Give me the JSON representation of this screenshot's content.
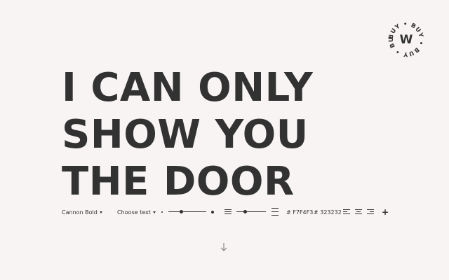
{
  "badge": {
    "letter": "W",
    "ring_text": "BUY • BUY • BUY • BUY •"
  },
  "headline": {
    "lines": [
      "I CAN ONLY",
      "SHOW YOU",
      "THE DOOR"
    ]
  },
  "toolbar": {
    "font_select": "Cannon Bold",
    "text_select": "Choose text",
    "size_value": 0.35,
    "line_height_value": 0.3,
    "background_color": "# F7F4F3",
    "text_color": "# 323232",
    "add_label": "+"
  },
  "colors": {
    "background": "#F7F4F3",
    "text": "#323232"
  },
  "icons": {
    "scroll": "arrow-down-icon",
    "small_size": "small-dot-icon",
    "large_size": "large-dot-icon",
    "tight_lines": "tight-lines-icon",
    "loose_lines": "loose-lines-icon",
    "align_left": "align-left-icon",
    "align_center": "align-center-icon",
    "align_right": "align-right-icon"
  }
}
